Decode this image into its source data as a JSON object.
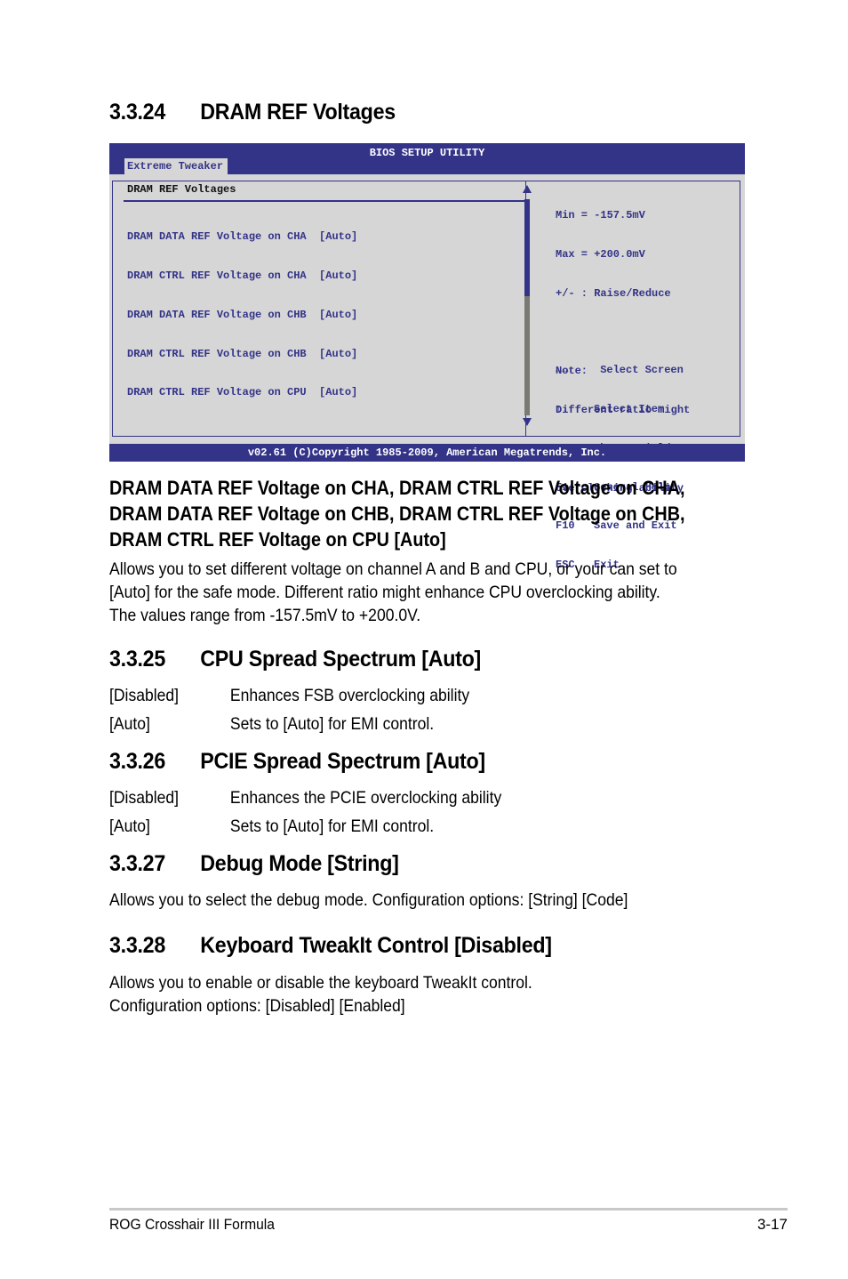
{
  "sections": {
    "s24": {
      "number": "3.3.24",
      "title": "DRAM REF Voltages"
    },
    "s25": {
      "number": "3.3.25",
      "title": "CPU Spread Spectrum [Auto]"
    },
    "s26": {
      "number": "3.3.26",
      "title": "PCIE Spread Spectrum [Auto]"
    },
    "s27": {
      "number": "3.3.27",
      "title": "Debug Mode [String]"
    },
    "s28": {
      "number": "3.3.28",
      "title": "Keyboard TweakIt Control [Disabled]"
    }
  },
  "bios": {
    "title": "BIOS SETUP UTILITY",
    "tab": "Extreme Tweaker",
    "panel_heading": "DRAM REF Voltages",
    "scroll_fraction_visible": 0.45,
    "items": [
      "DRAM DATA REF Voltage on CHA  [Auto]",
      "DRAM CTRL REF Voltage on CHA  [Auto]",
      "DRAM DATA REF Voltage on CHB  [Auto]",
      "DRAM CTRL REF Voltage on CHB  [Auto]",
      "DRAM CTRL REF Voltage on CPU  [Auto]"
    ],
    "help": [
      "Min = -157.5mV",
      "Max = +200.0mV",
      "+/- : Raise/Reduce",
      "",
      "Note:",
      "Different ratio might",
      "enhance DRAM",
      "overclocking ability"
    ],
    "keys": [
      {
        "key": "←→",
        "action": " Select Screen"
      },
      {
        "key": "↑↓",
        "action": "Select Item"
      },
      {
        "key": "+-",
        "action": "Change Field"
      },
      {
        "key": "F1",
        "action": "General Help"
      },
      {
        "key": "F10",
        "action": "Save and Exit"
      },
      {
        "key": "ESC",
        "action": "Exit"
      }
    ],
    "footer": "v02.61 (C)Copyright 1985-2009, American Megatrends, Inc.",
    "colors": {
      "accent": "#333388",
      "background": "#d6d6d6",
      "scrollbar": "#7a7a74"
    }
  },
  "dram_item": {
    "heading_lines": [
      "DRAM DATA REF Voltage on CHA, DRAM CTRL REF Voltage on CHA,",
      "DRAM DATA REF Voltage on CHB, DRAM CTRL REF Voltage on CHB,",
      "DRAM CTRL REF Voltage on CPU [Auto]"
    ],
    "body_lines": [
      "Allows you to set different voltage on channel A and B and CPU, or your can set to",
      "[Auto] for the safe mode. Different ratio might enhance CPU overclocking ability.",
      "The values range from -157.5mV to +200.0V."
    ]
  },
  "cpu_spread": {
    "options": [
      {
        "key": "[Disabled]",
        "desc": "Enhances FSB overclocking ability"
      },
      {
        "key": "[Auto]",
        "desc": "Sets to [Auto] for EMI control."
      }
    ]
  },
  "pcie_spread": {
    "options": [
      {
        "key": "[Disabled]",
        "desc": "Enhances the PCIE overclocking ability"
      },
      {
        "key": "[Auto]",
        "desc": "Sets to [Auto] for EMI control."
      }
    ]
  },
  "debug_mode": {
    "body": "Allows you to select the debug mode. Configuration options: [String] [Code]"
  },
  "keyboard_tweakit": {
    "body_lines": [
      "Allows you to enable or disable the keyboard TweakIt control.",
      "Configuration options: [Disabled] [Enabled]"
    ]
  },
  "footer": {
    "product": "ROG Crosshair III Formula",
    "page": "3-17"
  }
}
